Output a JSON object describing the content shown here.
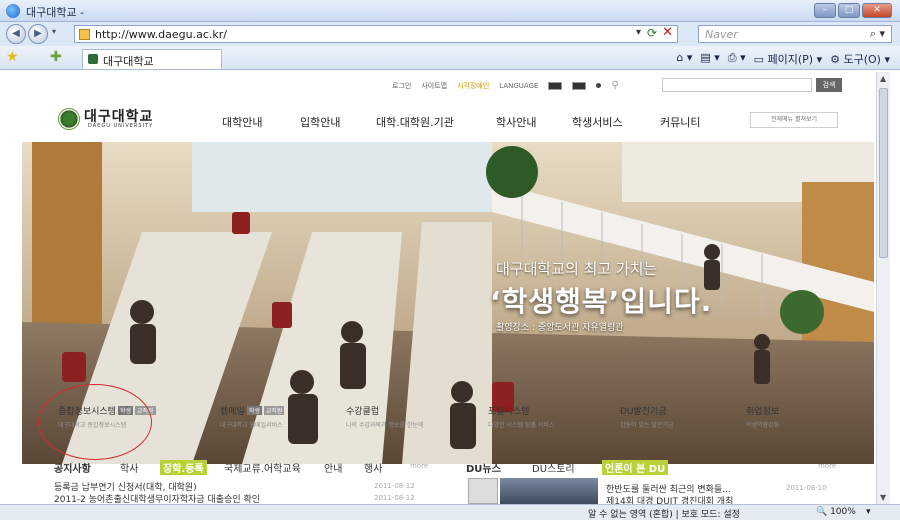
{
  "window": {
    "title": "대구대학교 -"
  },
  "address": {
    "url": "http://www.daegu.ac.kr/",
    "search_placeholder": "Naver"
  },
  "tab": {
    "label": "대구대학교"
  },
  "toolbar": {
    "page": "페이지(P)",
    "tools": "도구(O)"
  },
  "util": {
    "login": "로그인",
    "sitemap": "사이트맵",
    "visual": "시각장애인",
    "language": "LANGUAGE",
    "search_button": "검색"
  },
  "logo": {
    "name": "대구대학교",
    "sub": "DAEGU UNIVERSITY"
  },
  "gnb": [
    "대학안내",
    "입학안내",
    "대학.대학원.기관",
    "학사안내",
    "학생서비스",
    "커뮤니티"
  ],
  "full_menu": "전체메뉴 펼쳐보기",
  "hero": {
    "small": "대구대학교의 최고 가치는",
    "big": "‘학생행복’입니다.",
    "caption": "촬영장소 : 중앙도서관 자유열람관"
  },
  "quick_links": [
    {
      "name": "종합정보시스템",
      "b1": "학생",
      "b2": "교직원",
      "desc": "대구대학교 종합정보시스템"
    },
    {
      "name": "웹메일",
      "b1": "학생",
      "b2": "교직원",
      "desc": "대구대학교 웹메일서비스"
    },
    {
      "name": "수강클럽",
      "b1": "",
      "b2": "",
      "desc": "나의 수강과목과 정보를 한눈에"
    },
    {
      "name": "포털시스템",
      "b1": "",
      "b2": "",
      "desc": "다양한 시스템 맞춤 서비스"
    },
    {
      "name": "DU발전기금",
      "b1": "",
      "b2": "",
      "desc": "감동이 있는 발전기금"
    },
    {
      "name": "취업정보",
      "b1": "",
      "b2": "",
      "desc": "학생역량강화"
    }
  ],
  "news": {
    "tabs": [
      "공지사항",
      "학사",
      "장학.등록",
      "국제교류.어학교육",
      "안내",
      "행사",
      "more"
    ],
    "du_tabs": [
      "DU뉴스",
      "DU스토리",
      "언론이 본 DU",
      "more"
    ],
    "items": [
      {
        "title": "등록금 납부연기 신청서(대학, 대학원)",
        "date": "2011-08-12"
      },
      {
        "title": "2011-2 농어촌출신대학생무이자학자금 대출승인 확인",
        "date": "2011-08-12"
      }
    ],
    "du_items": [
      {
        "title": "한반도를 둘러싼 최근의 변화들...",
        "date": "2011-08-10"
      },
      {
        "title": "제14회 대경 DUIT 경진대회 개최",
        "date": ""
      }
    ]
  },
  "status": {
    "zone": "알 수 없는 영역 (혼합) | 보호 모드: 설정",
    "zoom": "100%"
  }
}
